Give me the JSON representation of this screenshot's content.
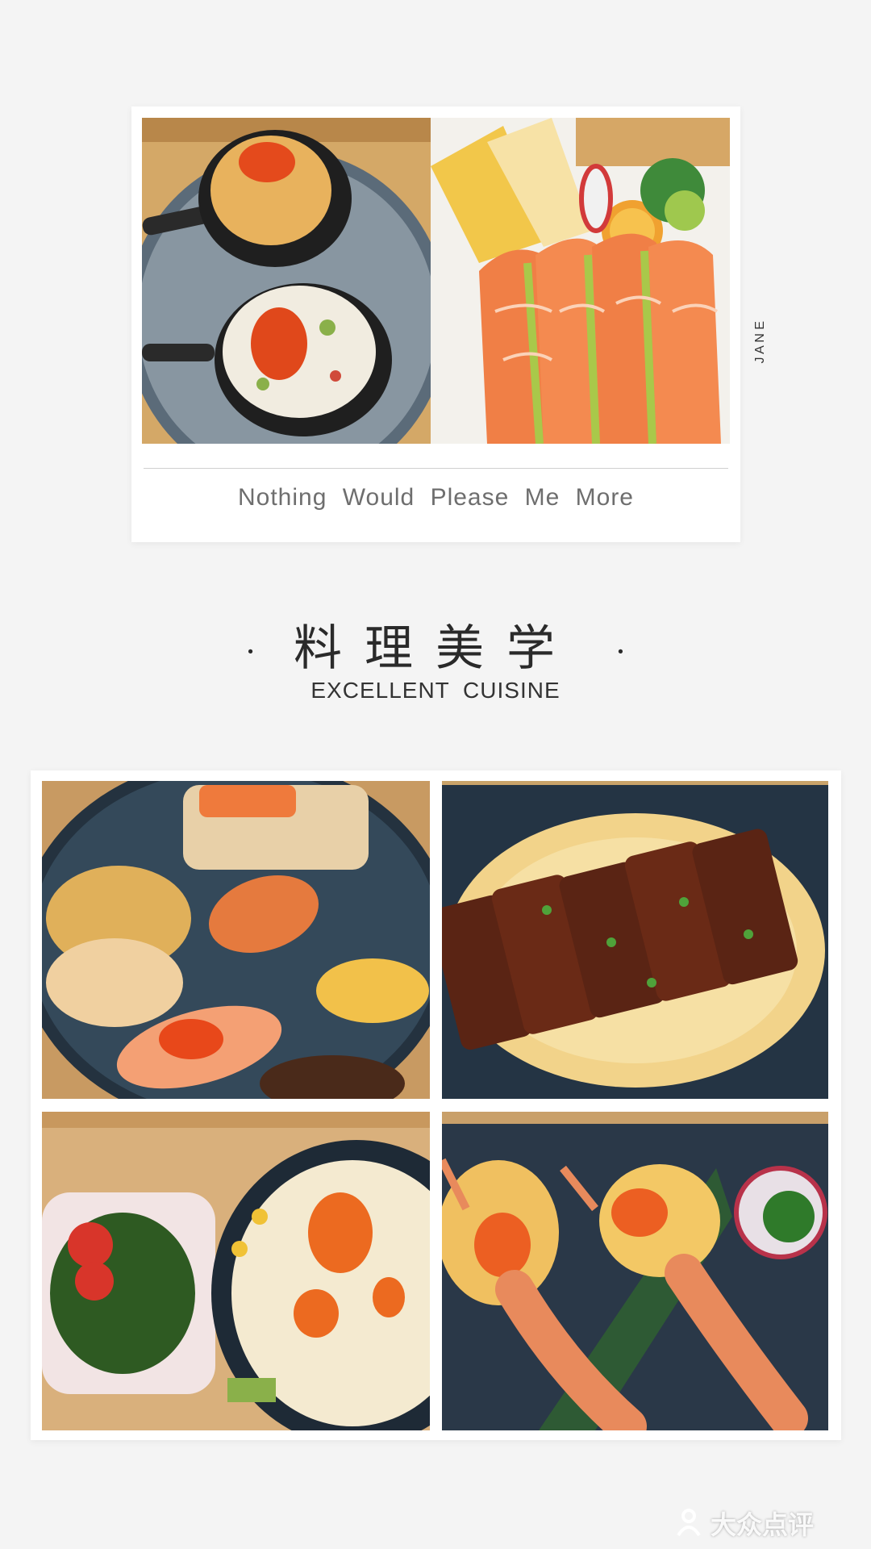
{
  "polaroid": {
    "caption": "Nothing Would Please Me More",
    "side_text": "J A N E",
    "photos": [
      "scallop-gratin-spoons-photo",
      "salmon-sashimi-photo"
    ]
  },
  "heading": {
    "dot_left": "·",
    "title_cn": "料理美学",
    "dot_right": "·",
    "title_en": "EXCELLENT CUISINE"
  },
  "grid": {
    "photos": [
      "sushi-rolls-platter-photo",
      "grilled-eel-photo",
      "seaweed-and-potato-salad-photo",
      "baked-prawns-photo"
    ]
  },
  "watermark": {
    "icon": "dianping-logo-icon",
    "text": "大众点评"
  }
}
